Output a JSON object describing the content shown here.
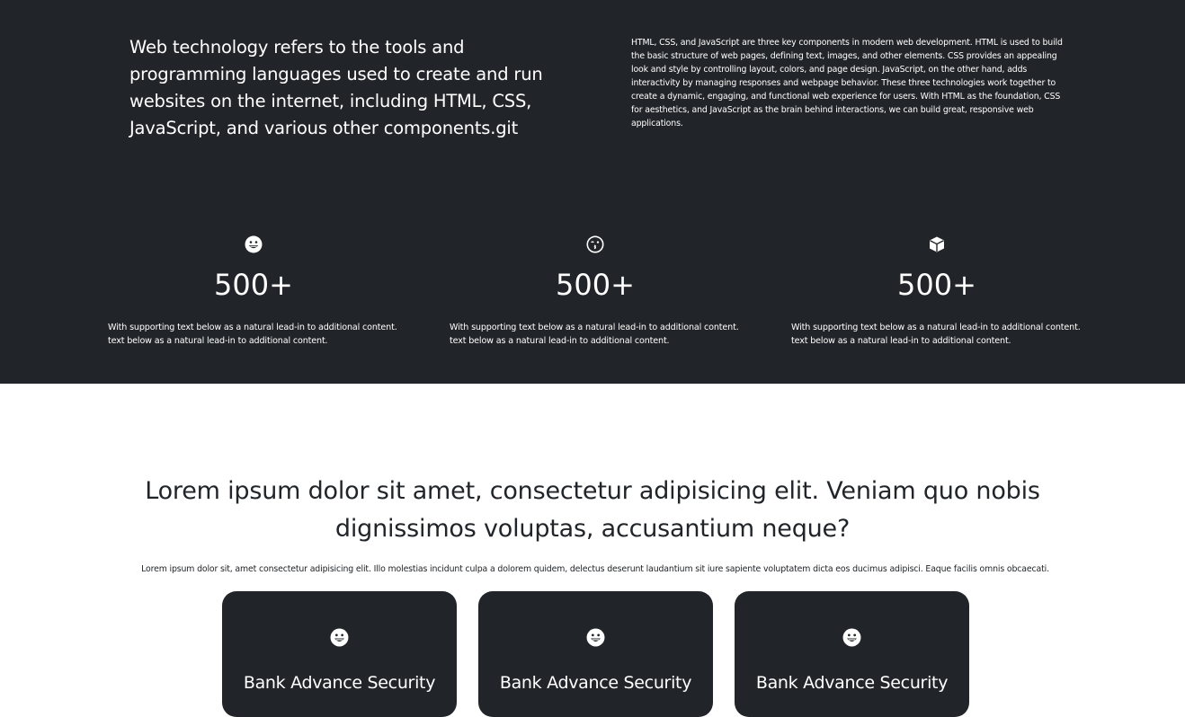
{
  "intro": {
    "heading": "Web technology refers to the tools and programming languages used to create and run websites on the internet, including HTML, CSS, JavaScript, and various other components.git",
    "paragraph": "HTML, CSS, and JavaScript are three key components in modern web development. HTML is used to build the basic structure of web pages, defining text, images, and other elements. CSS provides an appealing look and style by controlling layout, colors, and page design. JavaScript, on the other hand, adds interactivity by managing responses and webpage behavior. These three technologies work together to create a dynamic, engaging, and functional web experience for users. With HTML as the foundation, CSS for aesthetics, and JavaScript as the brain behind interactions, we can build great, responsive web applications."
  },
  "stats": [
    {
      "icon": "grin-icon",
      "value": "500+",
      "text": "With supporting text below as a natural lead-in to additional content. text below as a natural lead-in to additional content."
    },
    {
      "icon": "kiss-icon",
      "value": "500+",
      "text": "With supporting text below as a natural lead-in to additional content. text below as a natural lead-in to additional content."
    },
    {
      "icon": "box-icon",
      "value": "500+",
      "text": "With supporting text below as a natural lead-in to additional content. text below as a natural lead-in to additional content."
    }
  ],
  "section": {
    "title": "Lorem ipsum dolor sit amet, consectetur adipisicing elit. Veniam quo nobis dignissimos voluptas, accusantium neque?",
    "subtitle": "Lorem ipsum dolor sit, amet consectetur adipisicing elit. Illo molestias incidunt culpa a dolorem quidem, delectus deserunt laudantium sit iure sapiente voluptatem dicta eos ducimus adipisci. Eaque facilis omnis obcaecati."
  },
  "cards": [
    {
      "icon": "grin-icon",
      "title": "Bank Advance Security"
    },
    {
      "icon": "grin-icon",
      "title": "Bank Advance Security"
    },
    {
      "icon": "grin-icon",
      "title": "Bank Advance Security"
    }
  ],
  "colors": {
    "dark": "#212529",
    "light": "#ffffff"
  }
}
